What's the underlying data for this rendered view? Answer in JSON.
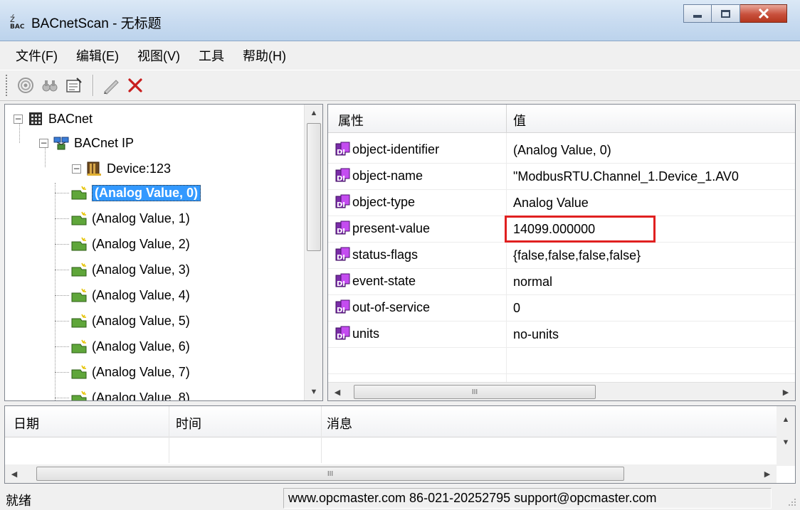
{
  "window": {
    "title": "BACnetScan - 无标题"
  },
  "menu": [
    "文件(F)",
    "编辑(E)",
    "视图(V)",
    "工具",
    "帮助(H)"
  ],
  "toolbar": {
    "buttons": [
      "scan-icon",
      "find-icon",
      "properties-icon",
      "write-icon",
      "delete-icon"
    ]
  },
  "tree": {
    "root": "BACnet",
    "network": "BACnet IP",
    "device": "Device:123",
    "objects": [
      "(Analog Value, 0)",
      "(Analog Value, 1)",
      "(Analog Value, 2)",
      "(Analog Value, 3)",
      "(Analog Value, 4)",
      "(Analog Value, 5)",
      "(Analog Value, 6)",
      "(Analog Value, 7)",
      "(Analog Value, 8)"
    ],
    "selected_index": 0
  },
  "properties": {
    "col_property": "属性",
    "col_value": "值",
    "rows": [
      {
        "name": "object-identifier",
        "value": "(Analog Value, 0)"
      },
      {
        "name": "object-name",
        "value": "\"ModbusRTU.Channel_1.Device_1.AV0"
      },
      {
        "name": "object-type",
        "value": "Analog Value"
      },
      {
        "name": "present-value",
        "value": "14099.000000"
      },
      {
        "name": "status-flags",
        "value": "{false,false,false,false}"
      },
      {
        "name": "event-state",
        "value": "normal"
      },
      {
        "name": "out-of-service",
        "value": "0"
      },
      {
        "name": "units",
        "value": "no-units"
      }
    ],
    "highlighted_row": "present-value"
  },
  "log": {
    "col_date": "日期",
    "col_time": "时间",
    "col_message": "消息"
  },
  "status": {
    "left": "就绪",
    "right": "www.opcmaster.com 86-021-20252795 support@opcmaster.com"
  },
  "colors": {
    "selection": "#3399ff",
    "highlight_border": "#e02020",
    "delete_icon": "#c81e1e"
  }
}
